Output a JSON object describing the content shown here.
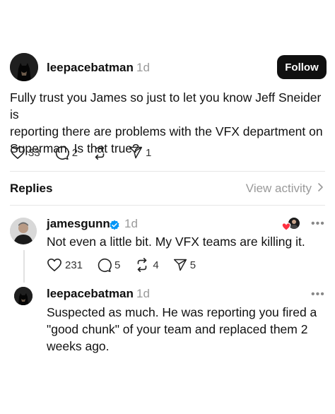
{
  "main_post": {
    "author": "leepacebatman",
    "time_ago": "1d",
    "follow_label": "Follow",
    "text_lines": [
      "Fully trust you James so just to let you know Jeff Sneider is",
      "reporting there are problems with the VFX department on",
      "Superman. Is that true?"
    ],
    "likes": "33",
    "comments": "2",
    "shares": "1"
  },
  "replies_section": {
    "title": "Replies",
    "view_activity_label": "View activity"
  },
  "reply_1": {
    "author": "jamesgunn",
    "time_ago": "1d",
    "text": "Not even a little bit. My VFX teams are killing it.",
    "likes": "231",
    "comments": "5",
    "reposts": "4",
    "shares": "5"
  },
  "reply_2": {
    "author": "leepacebatman",
    "time_ago": "1d",
    "text_lines": [
      "Suspected as much. He was reporting you fired a",
      "\"good chunk\" of your team and replaced them 2",
      "weeks ago."
    ]
  },
  "colors": {
    "verified": "#0095f6",
    "like_badge": "#ff3040",
    "text": "#101010",
    "muted": "#9a9a9a"
  },
  "icons": [
    "heart-icon",
    "comment-icon",
    "repost-icon",
    "share-icon",
    "verified-icon",
    "more-icon",
    "chevron-right-icon"
  ]
}
